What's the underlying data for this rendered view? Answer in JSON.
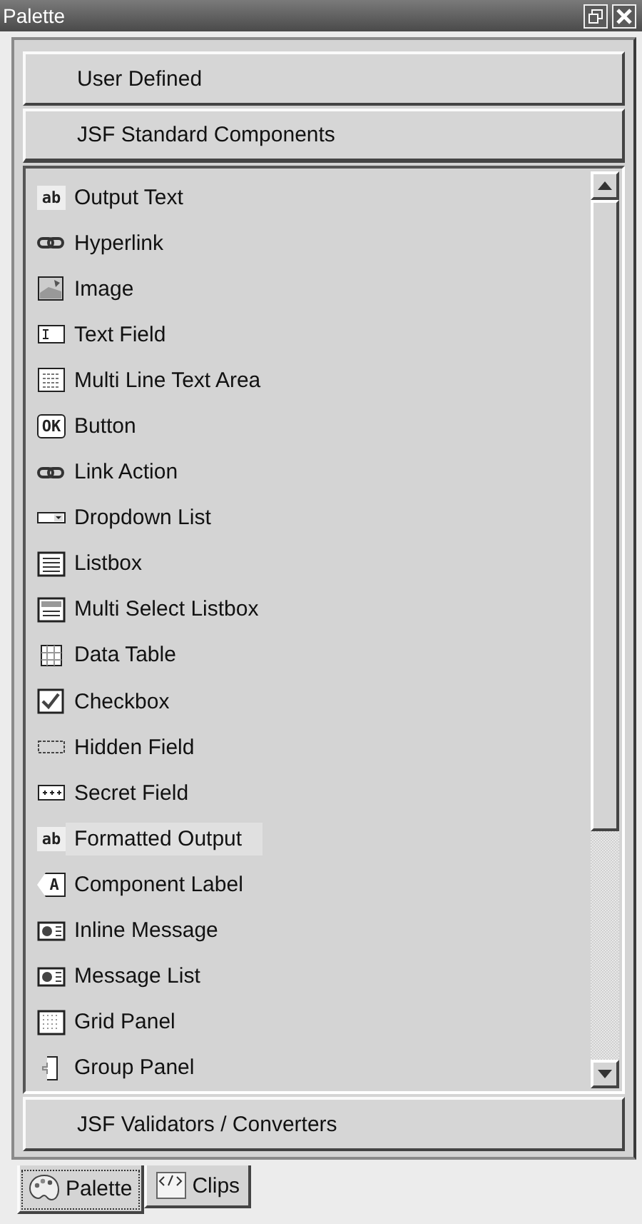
{
  "window": {
    "title": "Palette"
  },
  "sections_top": [
    {
      "label": "User Defined",
      "expanded": false
    },
    {
      "label": "JSF Standard Components",
      "expanded": true
    }
  ],
  "items": [
    {
      "label": "Output Text",
      "selected": false,
      "glyph": "ab"
    },
    {
      "label": "Hyperlink",
      "selected": false
    },
    {
      "label": "Image",
      "selected": false
    },
    {
      "label": "Text Field",
      "selected": false
    },
    {
      "label": "Multi Line Text Area",
      "selected": false
    },
    {
      "label": "Button",
      "selected": false,
      "glyph": "OK"
    },
    {
      "label": "Link Action",
      "selected": false
    },
    {
      "label": "Dropdown List",
      "selected": false
    },
    {
      "label": "Listbox",
      "selected": false
    },
    {
      "label": "Multi Select Listbox",
      "selected": false
    },
    {
      "label": "Data Table",
      "selected": false
    },
    {
      "label": "Checkbox",
      "selected": false
    },
    {
      "label": "Hidden Field",
      "selected": false
    },
    {
      "label": "Secret Field",
      "selected": false
    },
    {
      "label": "Formatted Output",
      "selected": true,
      "glyph": "ab"
    },
    {
      "label": "Component Label",
      "selected": false,
      "glyph": "A"
    },
    {
      "label": "Inline Message",
      "selected": false
    },
    {
      "label": "Message List",
      "selected": false
    },
    {
      "label": "Grid Panel",
      "selected": false
    },
    {
      "label": "Group Panel",
      "selected": false
    }
  ],
  "sections_bottom": [
    {
      "label": "JSF Validators / Converters",
      "expanded": false
    }
  ],
  "tabs": [
    {
      "label": "Palette",
      "selected": true
    },
    {
      "label": "Clips",
      "selected": false
    }
  ]
}
